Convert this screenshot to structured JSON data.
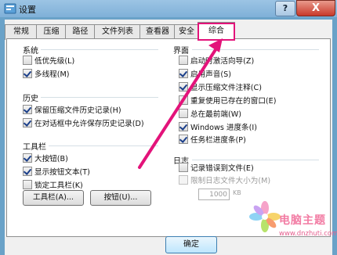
{
  "window": {
    "title": "设置",
    "help_label": "?",
    "close_label": "X"
  },
  "tabs": [
    "常规",
    "压缩",
    "路径",
    "文件列表",
    "查看器",
    "安全",
    "综合"
  ],
  "active_tab": "综合",
  "groups": {
    "system": {
      "title": "系统",
      "items": [
        {
          "label": "低优先级(L)",
          "checked": false
        },
        {
          "label": "多线程(M)",
          "checked": true
        }
      ]
    },
    "history": {
      "title": "历史",
      "items": [
        {
          "label": "保留压缩文件历史记录(H)",
          "checked": true
        },
        {
          "label": "在对话框中允许保存历史记录(D)",
          "checked": true
        }
      ]
    },
    "toolbar": {
      "title": "工具栏",
      "items": [
        {
          "label": "大按钮(B)",
          "checked": true
        },
        {
          "label": "显示按钮文本(T)",
          "checked": true
        },
        {
          "label": "锁定工具栏(K)",
          "checked": false
        }
      ],
      "toolbar_button": "工具栏(A)...",
      "buttons_button": "按钮(U)..."
    },
    "interface": {
      "title": "界面",
      "items": [
        {
          "label": "启动时激活向导(Z)",
          "checked": false
        },
        {
          "label": "启用声音(S)",
          "checked": true
        },
        {
          "label": "显示压缩文件注释(C)",
          "checked": true
        },
        {
          "label": "重复使用已存在的窗口(E)",
          "checked": false
        },
        {
          "label": "总在最前端(W)",
          "checked": false
        },
        {
          "label": "Windows 进度条(I)",
          "checked": true
        },
        {
          "label": "任务栏进度条(P)",
          "checked": true
        }
      ]
    },
    "log": {
      "title": "日志",
      "items": [
        {
          "label": "记录错误到文件(E)",
          "checked": false
        },
        {
          "label": "限制日志文件大小为(M)",
          "checked": false,
          "disabled": true
        }
      ],
      "size_value": "1000",
      "size_unit": "KB"
    }
  },
  "footer": {
    "ok_label": "确定"
  },
  "watermark": {
    "text": "电脑主题",
    "url": "www.dnzhuti.com"
  },
  "colors": {
    "highlight": "#e3137a",
    "titlebar": "#8bb8dd"
  }
}
